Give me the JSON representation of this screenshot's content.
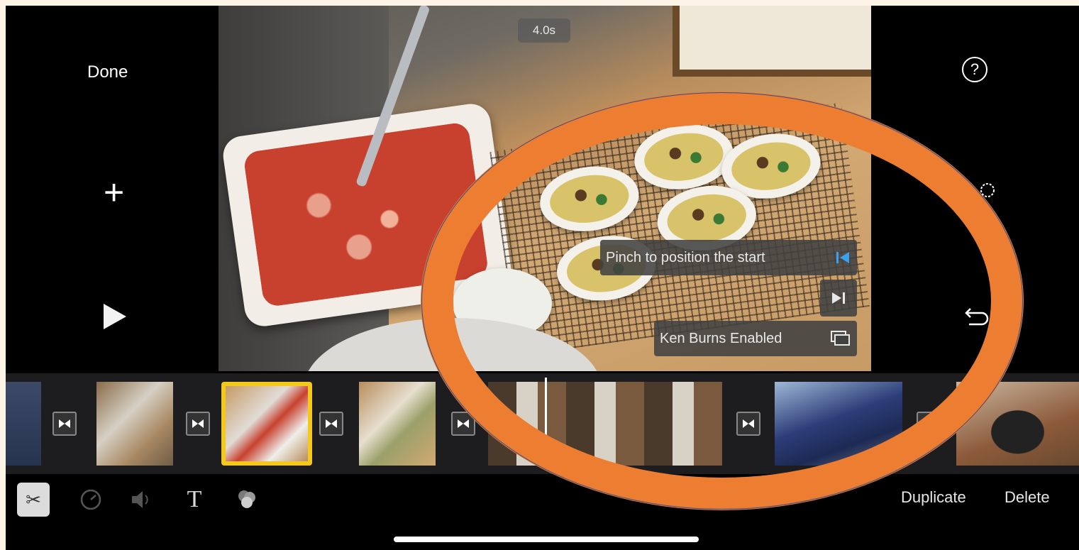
{
  "header": {
    "done_label": "Done",
    "duration": "4.0s"
  },
  "hints": {
    "pinch_start": "Pinch to position the start",
    "ken_burns": "Ken Burns Enabled"
  },
  "toolbar": {
    "duplicate_label": "Duplicate",
    "delete_label": "Delete",
    "title_tool_glyph": "T",
    "cut_tool_glyph": "✂"
  },
  "icons": {
    "help": "question-icon",
    "undo": "undo-icon",
    "add": "plus-icon",
    "play": "play-icon",
    "settings": "gear-icon",
    "start_marker": "skip-to-start-icon",
    "end_marker": "skip-to-end-icon",
    "ken_burns": "ken-burns-icon"
  },
  "colors": {
    "accent_selection": "#f4c91b",
    "hint_icon": "#3aa0f0",
    "callout": "#ed7d31"
  },
  "timeline": {
    "clip_count": 7,
    "selected_clip_index": 2
  }
}
